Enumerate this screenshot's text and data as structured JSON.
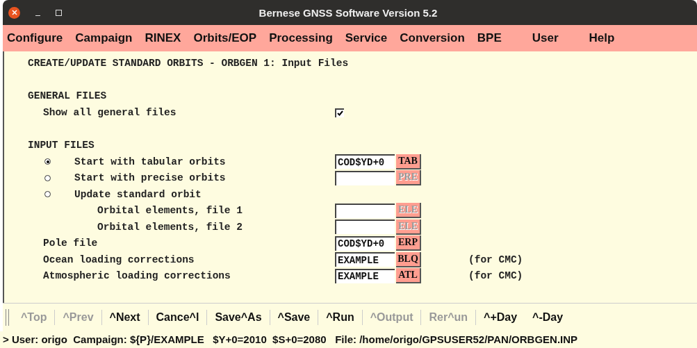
{
  "window": {
    "title": "Bernese GNSS Software Version 5.2"
  },
  "menu": [
    "Configure",
    "Campaign",
    "RINEX",
    "Orbits/EOP",
    "Processing",
    "Service",
    "Conversion",
    "BPE",
    "User",
    "Help"
  ],
  "panel": {
    "title": "CREATE/UPDATE STANDARD ORBITS - ORBGEN 1: Input Files",
    "sections": [
      {
        "heading": "GENERAL FILES",
        "items": [
          {
            "kind": "checkbox",
            "label": "Show all general files",
            "checked": true
          }
        ]
      },
      {
        "heading": "INPUT FILES",
        "items": [
          {
            "kind": "radio",
            "label": "Start with tabular orbits",
            "selected": true,
            "field": {
              "value": "COD$YD+0",
              "button": "TAB",
              "disabled": false
            }
          },
          {
            "kind": "radio",
            "label": "Start with precise orbits",
            "selected": false,
            "field": {
              "button": "PRE",
              "disabled": true
            }
          },
          {
            "kind": "radio",
            "label": "Update standard orbit",
            "selected": false,
            "children": [
              {
                "kind": "file",
                "label": "Orbital elements, file 1",
                "field": {
                  "button": "ELE",
                  "disabled": true
                }
              },
              {
                "kind": "file",
                "label": "Orbital elements, file 2",
                "field": {
                  "button": "ELE",
                  "disabled": true
                }
              }
            ]
          },
          {
            "kind": "file",
            "label": "Pole file",
            "field": {
              "value": "COD$YD+0",
              "button": "ERP",
              "disabled": false
            }
          },
          {
            "kind": "file",
            "label": "Ocean loading corrections",
            "field": {
              "value": "EXAMPLE",
              "button": "BLQ",
              "disabled": false
            },
            "note": "(for CMC)"
          },
          {
            "kind": "file",
            "label": "Atmospheric loading corrections",
            "field": {
              "value": "EXAMPLE",
              "button": "ATL",
              "disabled": false
            },
            "note": "(for CMC)"
          }
        ]
      }
    ]
  },
  "toolbar": [
    {
      "label": "^Top",
      "disabled": true
    },
    {
      "label": "^Prev",
      "disabled": true
    },
    {
      "label": "^Next",
      "disabled": false
    },
    {
      "label": "Cance^l",
      "disabled": false
    },
    {
      "label": "Save^As",
      "disabled": false
    },
    {
      "label": "^Save",
      "disabled": false
    },
    {
      "label": "^Run",
      "disabled": false
    },
    {
      "label": "^Output",
      "disabled": true
    },
    {
      "label": "Rer^un",
      "disabled": true
    },
    {
      "label": "^+Day",
      "disabled": false
    },
    {
      "label": "^-Day",
      "disabled": false
    }
  ],
  "status_bar": "> User: origo  Campaign: ${P}/EXAMPLE   $Y+0=2010  $S+0=2080   File: /home/origo/GPSUSER52/PAN/ORBGEN.INP"
}
